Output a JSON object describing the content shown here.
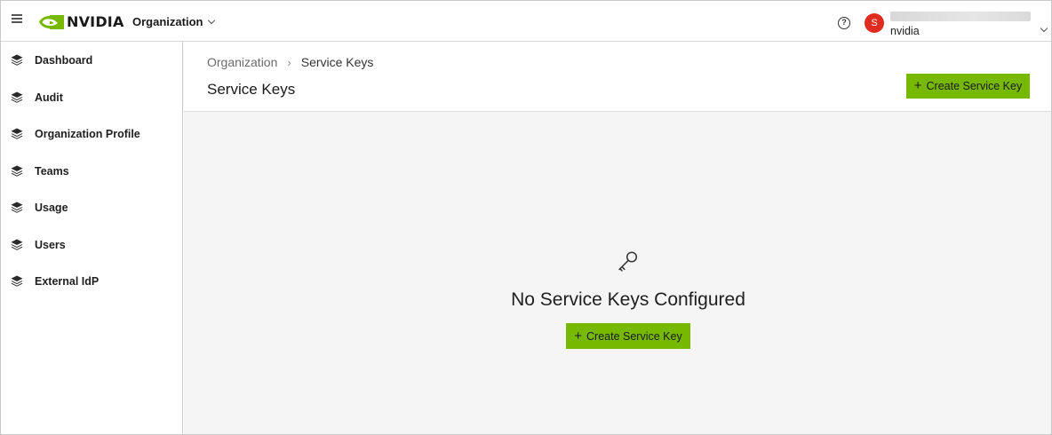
{
  "header": {
    "brand": "NVIDIA",
    "org_switcher": "Organization",
    "help_symbol": "?",
    "user_initial": "S",
    "user_org": "nvidia",
    "accent_color": "#76b900"
  },
  "sidebar": {
    "items": [
      {
        "label": "Dashboard",
        "icon": "layers-icon"
      },
      {
        "label": "Audit",
        "icon": "layers-icon"
      },
      {
        "label": "Organization Profile",
        "icon": "layers-icon"
      },
      {
        "label": "Teams",
        "icon": "layers-icon"
      },
      {
        "label": "Usage",
        "icon": "layers-icon"
      },
      {
        "label": "Users",
        "icon": "layers-icon"
      },
      {
        "label": "External IdP",
        "icon": "layers-icon"
      }
    ]
  },
  "main": {
    "breadcrumb": {
      "parent": "Organization",
      "separator": "›",
      "current": "Service Keys"
    },
    "title": "Service Keys",
    "create_button": "Create Service Key",
    "empty_state": {
      "icon": "key-icon",
      "title": "No Service Keys Configured",
      "button": "Create Service Key"
    }
  }
}
